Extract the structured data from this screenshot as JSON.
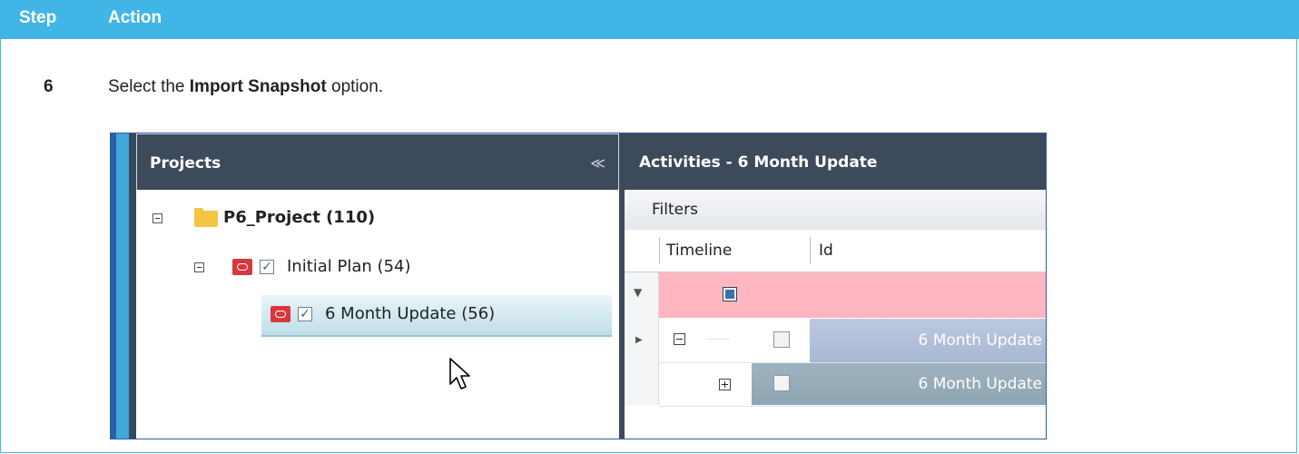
{
  "header": {
    "step_label": "Step",
    "action_label": "Action"
  },
  "step": {
    "number": "6",
    "text_before": "Select the ",
    "text_bold": "Import Snapshot",
    "text_after": " option."
  },
  "projects_panel": {
    "title": "Projects",
    "collapse_glyph": "≪",
    "tree": [
      {
        "label": "P6_Project (110)",
        "icon": "folder-icon"
      },
      {
        "label": "Initial  Plan (54)",
        "icon": "oracle-icon",
        "checked": true
      },
      {
        "label": "6 Month Update (56)",
        "icon": "oracle-icon",
        "checked": true,
        "selected": true
      }
    ]
  },
  "activities_panel": {
    "title": "Activities - 6 Month Update",
    "filters_label": "Filters",
    "columns": [
      "Timeline",
      "Id"
    ],
    "rows": [
      {
        "label": "6 Month Update"
      },
      {
        "label": "6 Month Update"
      }
    ]
  },
  "colors": {
    "header_bg": "#41b6e6",
    "panel_head_bg": "#3d4a5b",
    "filter_row_bg": "#ffb6c1"
  }
}
